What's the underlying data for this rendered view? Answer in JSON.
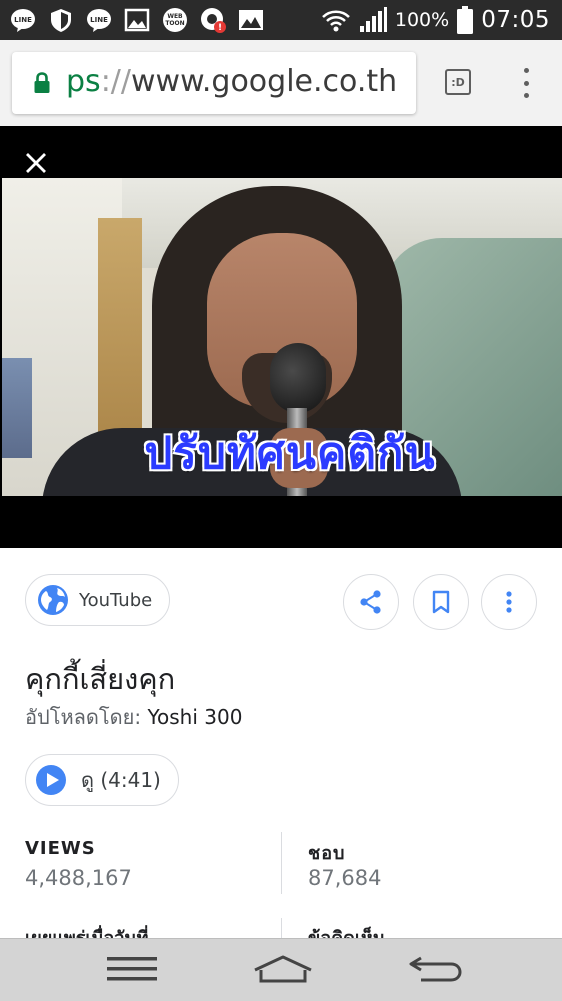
{
  "status_bar": {
    "notification_icons": [
      "line-icon",
      "shield-icon",
      "line-icon",
      "image-icon",
      "webtoon-icon",
      "alert-app-icon",
      "photo-icon"
    ],
    "line_label": "LINE",
    "webtoon_label": "WEB TOON",
    "battery_percent": "100%",
    "time": "07:05"
  },
  "browser": {
    "url_scheme": "ps",
    "url_sep": "://",
    "url_host": "www.google.co.th",
    "tabs_label": ":D"
  },
  "video": {
    "caption": "ปรับทัศนคติกัน"
  },
  "result": {
    "source_label": "YouTube",
    "title": "คุกกี้เสี่ยงคุก",
    "uploader_prefix": "อัปโหลดโดย:",
    "uploader_name": "Yoshi 300",
    "watch_label": "ดู (4:41)",
    "stats": {
      "views_label": "VIEWS",
      "views_value": "4,488,167",
      "likes_label": "ชอบ",
      "likes_value": "87,684",
      "published_label": "เผยแพร่เมื่อวันที่",
      "comments_label": "ข้อคิดเห็น"
    }
  },
  "colors": {
    "status_bar": "#2b2b2b",
    "accent_blue": "#4285f4",
    "url_green": "#0b8043",
    "caption_blue": "#2b3bff"
  }
}
